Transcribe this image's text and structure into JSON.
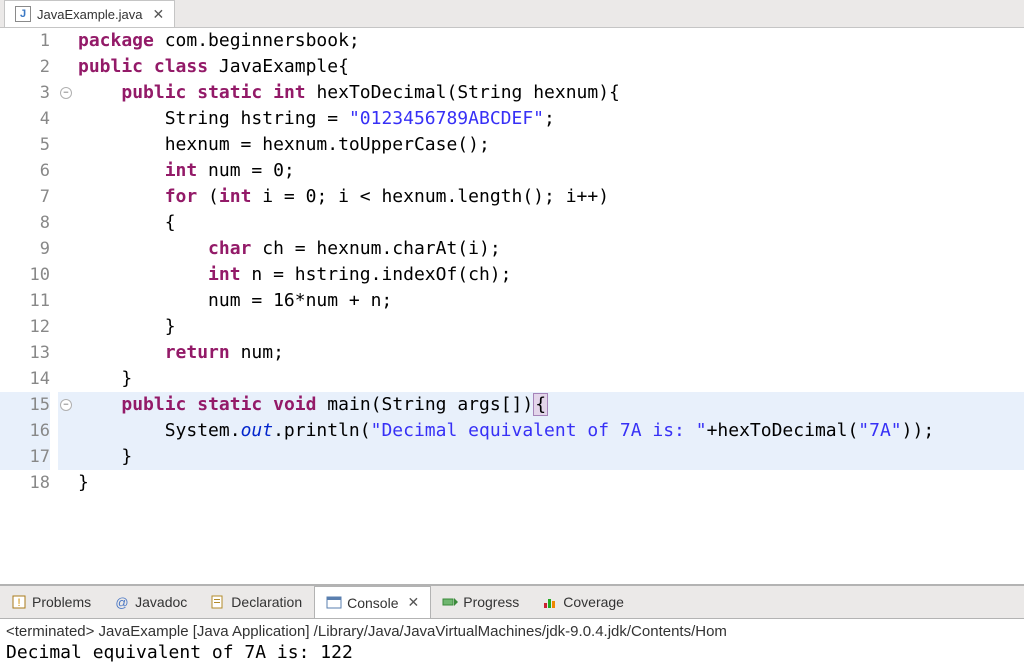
{
  "tab": {
    "filename": "JavaExample.java",
    "icon_letter": "J",
    "close": "✕"
  },
  "code": {
    "lines": [
      {
        "n": "1",
        "seg": [
          {
            "cls": "kw",
            "t": "package"
          },
          {
            "cls": "plain",
            "t": " com.beginnersbook;"
          }
        ]
      },
      {
        "n": "2",
        "seg": [
          {
            "cls": "kw",
            "t": "public"
          },
          {
            "cls": "plain",
            "t": " "
          },
          {
            "cls": "kw",
            "t": "class"
          },
          {
            "cls": "plain",
            "t": " JavaExample{"
          }
        ]
      },
      {
        "n": "3",
        "fold": true,
        "seg": [
          {
            "cls": "plain",
            "t": "    "
          },
          {
            "cls": "kw",
            "t": "public"
          },
          {
            "cls": "plain",
            "t": " "
          },
          {
            "cls": "kw",
            "t": "static"
          },
          {
            "cls": "plain",
            "t": " "
          },
          {
            "cls": "type",
            "t": "int"
          },
          {
            "cls": "plain",
            "t": " hexToDecimal(String hexnum){"
          }
        ]
      },
      {
        "n": "4",
        "seg": [
          {
            "cls": "plain",
            "t": "        String hstring = "
          },
          {
            "cls": "str",
            "t": "\"0123456789ABCDEF\""
          },
          {
            "cls": "plain",
            "t": ";"
          }
        ]
      },
      {
        "n": "5",
        "seg": [
          {
            "cls": "plain",
            "t": "        hexnum = hexnum.toUpperCase();"
          }
        ]
      },
      {
        "n": "6",
        "seg": [
          {
            "cls": "plain",
            "t": "        "
          },
          {
            "cls": "type",
            "t": "int"
          },
          {
            "cls": "plain",
            "t": " num = 0;"
          }
        ]
      },
      {
        "n": "7",
        "seg": [
          {
            "cls": "plain",
            "t": "        "
          },
          {
            "cls": "kw",
            "t": "for"
          },
          {
            "cls": "plain",
            "t": " ("
          },
          {
            "cls": "type",
            "t": "int"
          },
          {
            "cls": "plain",
            "t": " i = 0; i < hexnum.length(); i++)"
          }
        ]
      },
      {
        "n": "8",
        "seg": [
          {
            "cls": "plain",
            "t": "        {"
          }
        ]
      },
      {
        "n": "9",
        "seg": [
          {
            "cls": "plain",
            "t": "            "
          },
          {
            "cls": "type",
            "t": "char"
          },
          {
            "cls": "plain",
            "t": " ch = hexnum.charAt(i);"
          }
        ]
      },
      {
        "n": "10",
        "seg": [
          {
            "cls": "plain",
            "t": "            "
          },
          {
            "cls": "type",
            "t": "int"
          },
          {
            "cls": "plain",
            "t": " n = hstring.indexOf(ch);"
          }
        ]
      },
      {
        "n": "11",
        "seg": [
          {
            "cls": "plain",
            "t": "            num = 16*num + n;"
          }
        ]
      },
      {
        "n": "12",
        "seg": [
          {
            "cls": "plain",
            "t": "        }"
          }
        ]
      },
      {
        "n": "13",
        "seg": [
          {
            "cls": "plain",
            "t": "        "
          },
          {
            "cls": "kw",
            "t": "return"
          },
          {
            "cls": "plain",
            "t": " num;"
          }
        ]
      },
      {
        "n": "14",
        "seg": [
          {
            "cls": "plain",
            "t": "    }"
          }
        ]
      },
      {
        "n": "15",
        "fold": true,
        "hl": true,
        "seg": [
          {
            "cls": "plain",
            "t": "    "
          },
          {
            "cls": "kw",
            "t": "public"
          },
          {
            "cls": "plain",
            "t": " "
          },
          {
            "cls": "kw",
            "t": "static"
          },
          {
            "cls": "plain",
            "t": " "
          },
          {
            "cls": "type",
            "t": "void"
          },
          {
            "cls": "plain",
            "t": " main(String args[])"
          },
          {
            "cls": "caret-brace",
            "t": "{"
          }
        ]
      },
      {
        "n": "16",
        "hl": true,
        "seg": [
          {
            "cls": "plain",
            "t": "        System."
          },
          {
            "cls": "stat-field",
            "t": "out"
          },
          {
            "cls": "plain",
            "t": ".println("
          },
          {
            "cls": "str",
            "t": "\"Decimal equivalent of 7A is: \""
          },
          {
            "cls": "plain",
            "t": "+hexToDecimal("
          },
          {
            "cls": "str",
            "t": "\"7A\""
          },
          {
            "cls": "plain",
            "t": "));"
          }
        ]
      },
      {
        "n": "17",
        "hl": true,
        "seg": [
          {
            "cls": "plain",
            "t": "    }"
          }
        ]
      },
      {
        "n": "18",
        "seg": [
          {
            "cls": "plain",
            "t": "}"
          }
        ]
      }
    ]
  },
  "bottom_tabs": {
    "problems": "Problems",
    "javadoc": "Javadoc",
    "declaration": "Declaration",
    "console": "Console",
    "console_close": "✕",
    "progress": "Progress",
    "coverage": "Coverage"
  },
  "console": {
    "status_prefix": "<terminated>",
    "status_body": " JavaExample [Java Application] /Library/Java/JavaVirtualMachines/jdk-9.0.4.jdk/Contents/Hom",
    "output": "Decimal equivalent of 7A is: 122"
  }
}
